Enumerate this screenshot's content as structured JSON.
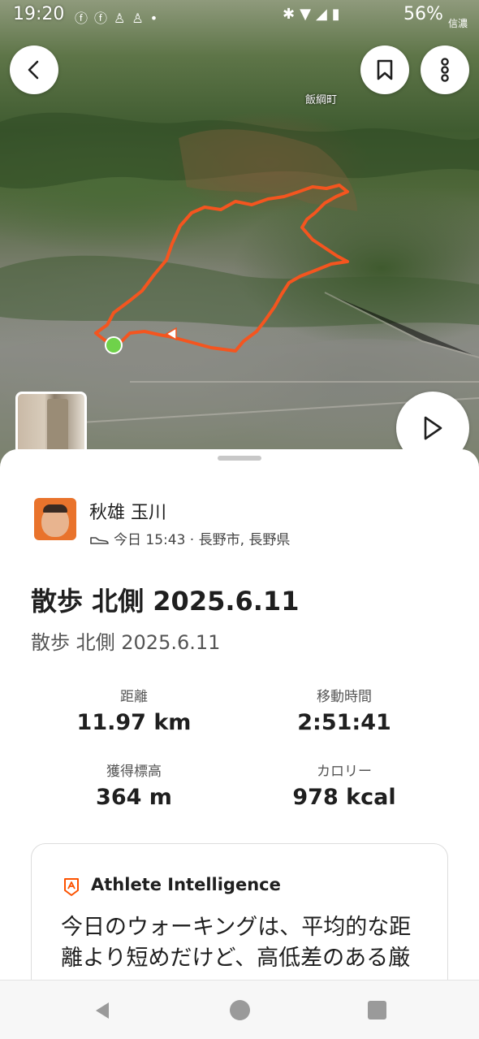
{
  "status_bar": {
    "time": "19:20",
    "battery": "56%",
    "carrier": "信濃",
    "left_icons": [
      "facebook-icon",
      "facebook-icon",
      "person-icon",
      "person-icon",
      "dot-icon"
    ],
    "right_icons": [
      "bluetooth-icon",
      "wifi-icon",
      "signal-icon",
      "battery-icon"
    ]
  },
  "map": {
    "place_label": "飯綱町",
    "route_color": "#f4551f",
    "start_marker_color": "#6fd24a"
  },
  "actions": {
    "back_icon": "chevron-left-icon",
    "bookmark_icon": "bookmark-icon",
    "more_icon": "more-vertical-icon",
    "play_icon": "play-icon"
  },
  "athlete": {
    "name": "秋雄 玉川",
    "meta": "今日 15:43 · 長野市, 長野県",
    "activity_icon": "shoe-icon"
  },
  "activity": {
    "title": "散歩 北側 2025.6.11",
    "description": "散歩 北側 2025.6.11"
  },
  "stats": [
    {
      "label": "距離",
      "value": "11.97 km"
    },
    {
      "label": "移動時間",
      "value": "2:51:41"
    },
    {
      "label": "獲得標高",
      "value": "364 m"
    },
    {
      "label": "カロリー",
      "value": "978 kcal"
    }
  ],
  "athlete_intelligence": {
    "title": "Athlete Intelligence",
    "text": "今日のウォーキングは、平均的な距離より短めだけど、高低差のある厳",
    "accent": "#fc5200"
  },
  "nav": {
    "icons": [
      "back-triangle-icon",
      "home-circle-icon",
      "recents-square-icon"
    ]
  }
}
